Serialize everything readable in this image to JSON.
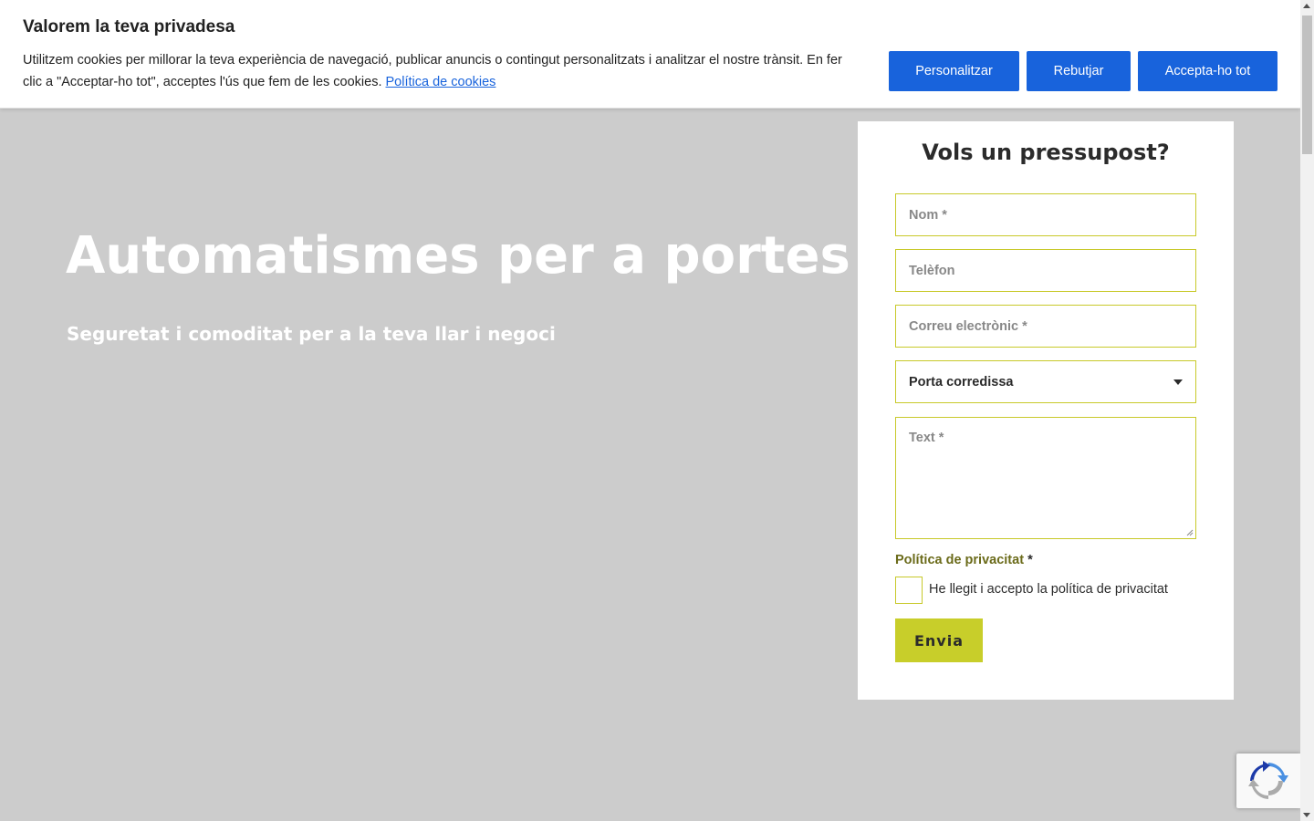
{
  "hero": {
    "title": "Automatismes per a portes",
    "subtitle": "Seguretat i comoditat per a la teva llar i negoci"
  },
  "cookie_banner": {
    "title": "Valorem la teva privadesa",
    "text": "Utilitzem cookies per millorar la teva experiència de navegació, publicar anuncis o contingut personalitzats i analitzar el nostre trànsit. En fer clic a \"Acceptar-ho tot\", acceptes l'ús que fem de les cookies.",
    "policy_link": "Política de cookies",
    "buttons": {
      "personalize": "Personalitzar",
      "reject": "Rebutjar",
      "accept": "Accepta-ho tot"
    },
    "accent_color": "#1863dc"
  },
  "form": {
    "title": "Vols un pressupost?",
    "name_placeholder": "Nom *",
    "phone_placeholder": "Telèfon",
    "email_placeholder": "Correu electrònic *",
    "select_value": "Porta corredissa",
    "text_placeholder": "Text *",
    "privacy_label": "Política de privacitat",
    "privacy_required": "*",
    "privacy_checkbox_label": "He llegit i accepto la política de privacitat",
    "submit_label": "Envia",
    "accent_color": "#c8ce2a"
  },
  "recaptcha": {
    "icon": "recaptcha-icon"
  }
}
